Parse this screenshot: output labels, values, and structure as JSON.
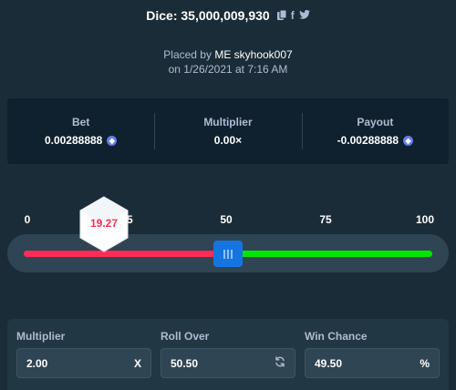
{
  "header": {
    "title": "Dice: 35,000,009,930",
    "icons": [
      "copy-icon",
      "facebook-icon",
      "twitter-icon"
    ]
  },
  "placed": {
    "prefix": "Placed by",
    "user": "ME skyhook007",
    "date_line": "on 1/26/2021 at 7:16 AM"
  },
  "summary": {
    "bet_label": "Bet",
    "bet_value": "0.00288888",
    "multiplier_label": "Multiplier",
    "multiplier_value": "0.00×",
    "payout_label": "Payout",
    "payout_value": "-0.00288888",
    "currency_icon": "ethereum-coin-icon"
  },
  "slider": {
    "ticks": [
      "0",
      "25",
      "50",
      "75",
      "100"
    ],
    "roll_over": 50.5,
    "result": "19.27",
    "colors": {
      "lose": "#ff2c55",
      "win": "#00e701",
      "handle": "#1475e1"
    }
  },
  "controls": {
    "multiplier_label": "Multiplier",
    "multiplier_value": "2.00",
    "multiplier_suffix": "X",
    "roll_over_label": "Roll Over",
    "roll_over_value": "50.50",
    "roll_over_icon": "refresh-icon",
    "win_chance_label": "Win Chance",
    "win_chance_value": "49.50",
    "win_chance_suffix": "%"
  }
}
